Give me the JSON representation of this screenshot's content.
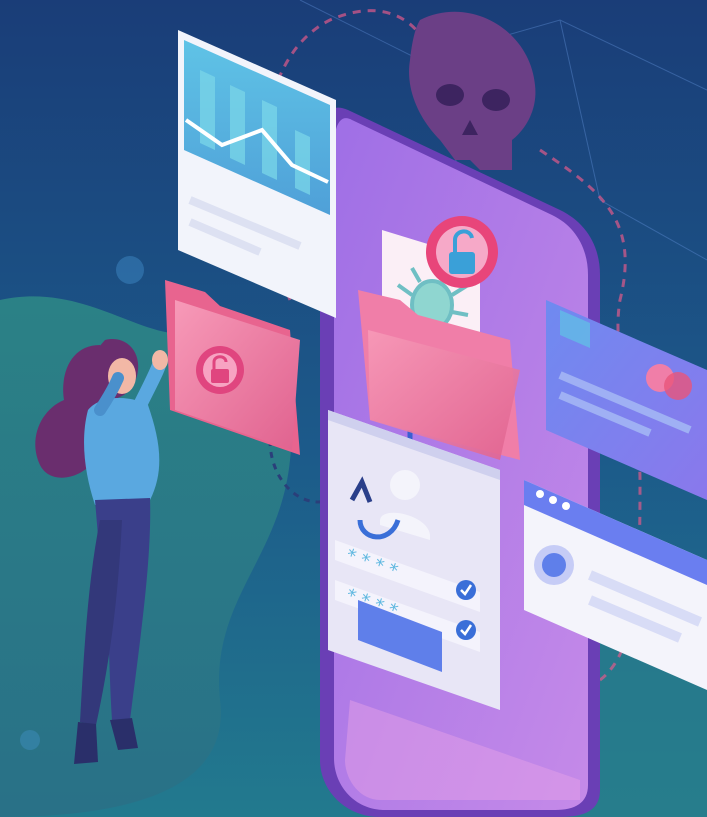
{
  "colors": {
    "bg_top": "#1a3f7a",
    "bg_bottom": "#1f6d8a",
    "teal_blob": "#2f8f8a",
    "phone_body": "#b07be8",
    "phone_dark": "#6a3fb5",
    "card_blue": "#7d8cf0",
    "pink_folder": "#f07ea8",
    "skull": "#6b3f86",
    "woman_shirt": "#5aa8e0",
    "woman_pants": "#3a3f8a",
    "woman_hair": "#6a2e6e",
    "check_blue": "#3a6fd8",
    "lock_ring": "#e8457a"
  },
  "icons": [
    "skull-icon",
    "bug-icon",
    "open-lock-icon",
    "user-icon",
    "check-icon",
    "credit-card-icon",
    "browser-window-icon"
  ],
  "password_mask": "* * * *"
}
